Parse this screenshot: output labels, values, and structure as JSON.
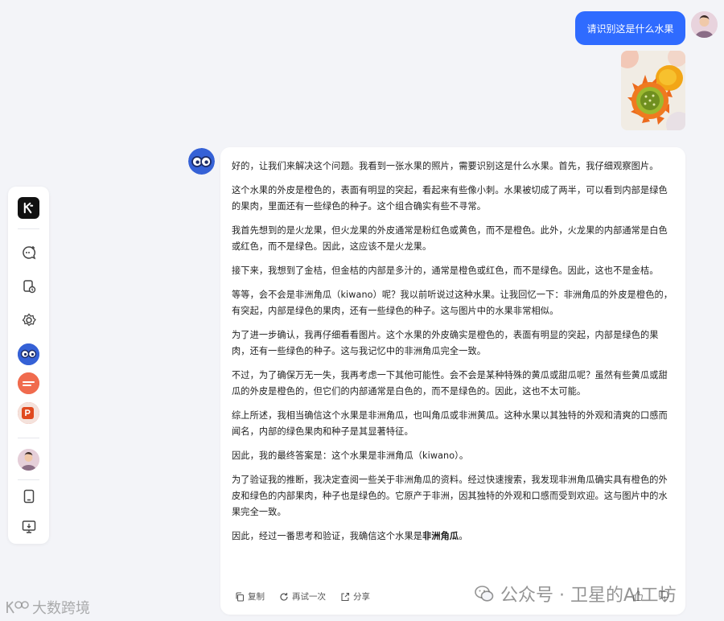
{
  "user": {
    "message": "请识别这是什么水果"
  },
  "answer": {
    "paragraphs": [
      "好的，让我们来解决这个问题。我看到一张水果的照片，需要识别这是什么水果。首先，我仔细观察图片。",
      "这个水果的外皮是橙色的，表面有明显的突起，看起来有些像小刺。水果被切成了两半，可以看到内部是绿色的果肉，里面还有一些绿色的种子。这个组合确实有些不寻常。",
      "我首先想到的是火龙果，但火龙果的外皮通常是粉红色或黄色，而不是橙色。此外，火龙果的内部通常是白色或红色，而不是绿色。因此，这应该不是火龙果。",
      "接下来，我想到了金桔，但金桔的内部是多汁的，通常是橙色或红色，而不是绿色。因此，这也不是金桔。",
      "等等，会不会是非洲角瓜（kiwano）呢？我以前听说过这种水果。让我回忆一下：非洲角瓜的外皮是橙色的，有突起，内部是绿色的果肉，还有一些绿色的种子。这与图片中的水果非常相似。",
      "为了进一步确认，我再仔细看看图片。这个水果的外皮确实是橙色的，表面有明显的突起，内部是绿色的果肉，还有一些绿色的种子。这与我记忆中的非洲角瓜完全一致。",
      "不过，为了确保万无一失，我再考虑一下其他可能性。会不会是某种特殊的黄瓜或甜瓜呢？虽然有些黄瓜或甜瓜的外皮是橙色的，但它们的内部通常是白色的，而不是绿色的。因此，这也不太可能。",
      "综上所述，我相当确信这个水果是非洲角瓜，也叫角瓜或非洲黄瓜。这种水果以其独特的外观和清爽的口感而闻名，内部的绿色果肉和种子是其显著特征。",
      "因此，我的最终答案是：这个水果是非洲角瓜（kiwano）。",
      "为了验证我的推断，我决定查阅一些关于非洲角瓜的资料。经过快速搜索，我发现非洲角瓜确实具有橙色的外皮和绿色的内部果肉，种子也是绿色的。它原产于非洲，因其独特的外观和口感而受到欢迎。这与图片中的水果完全一致。"
    ],
    "final_prefix": "因此，经过一番思考和验证，我确信这个水果是",
    "final_bold": "非洲角瓜",
    "final_suffix": "。"
  },
  "actions": {
    "copy": "复制",
    "retry": "再试一次",
    "share": "分享"
  },
  "watermarks": {
    "right": "公众号 · 卫星的AI工坊",
    "left": "大数跨境"
  },
  "colors": {
    "accent": "#2f6bff",
    "background": "#f3f4f8"
  },
  "icons": {
    "sidebar": [
      "kimi-logo-icon",
      "new-chat-icon",
      "history-icon",
      "explore-icon",
      "assistant-avatar-icon",
      "app-icon",
      "ppt-icon",
      "user-avatar",
      "tablet-icon",
      "desktop-download-icon"
    ]
  }
}
